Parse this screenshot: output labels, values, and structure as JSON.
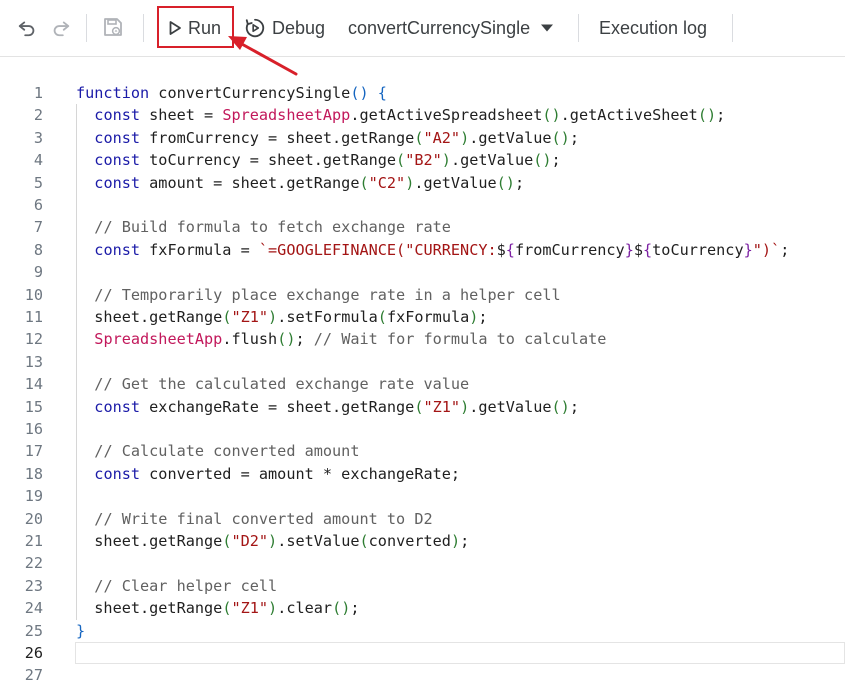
{
  "toolbar": {
    "undo_icon": "undo-icon",
    "redo_icon": "redo-icon",
    "save_icon": "save-drive-icon",
    "run_label": "Run",
    "debug_label": "Debug",
    "function_select": "convertCurrencySingle",
    "execution_log_label": "Execution log"
  },
  "editor": {
    "active_line": 26,
    "lines": [
      {
        "n": "1",
        "tokens": [
          [
            "kw",
            "function"
          ],
          [
            "pn",
            " convertCurrencySingle"
          ],
          [
            "p1",
            "()"
          ],
          [
            "pn",
            " "
          ],
          [
            "p1",
            "{"
          ]
        ]
      },
      {
        "n": "2",
        "tokens": [
          [
            "pn",
            "  "
          ],
          [
            "kw",
            "const"
          ],
          [
            "pn",
            " sheet = "
          ],
          [
            "cls",
            "SpreadsheetApp"
          ],
          [
            "pn",
            ".getActiveSpreadsheet"
          ],
          [
            "p2",
            "()"
          ],
          [
            "pn",
            ".getActiveSheet"
          ],
          [
            "p2",
            "()"
          ],
          [
            "pn",
            ";"
          ]
        ]
      },
      {
        "n": "3",
        "tokens": [
          [
            "pn",
            "  "
          ],
          [
            "kw",
            "const"
          ],
          [
            "pn",
            " fromCurrency = sheet.getRange"
          ],
          [
            "p2",
            "("
          ],
          [
            "str",
            "\"A2\""
          ],
          [
            "p2",
            ")"
          ],
          [
            "pn",
            ".getValue"
          ],
          [
            "p2",
            "()"
          ],
          [
            "pn",
            ";"
          ]
        ]
      },
      {
        "n": "4",
        "tokens": [
          [
            "pn",
            "  "
          ],
          [
            "kw",
            "const"
          ],
          [
            "pn",
            " toCurrency = sheet.getRange"
          ],
          [
            "p2",
            "("
          ],
          [
            "str",
            "\"B2\""
          ],
          [
            "p2",
            ")"
          ],
          [
            "pn",
            ".getValue"
          ],
          [
            "p2",
            "()"
          ],
          [
            "pn",
            ";"
          ]
        ]
      },
      {
        "n": "5",
        "tokens": [
          [
            "pn",
            "  "
          ],
          [
            "kw",
            "const"
          ],
          [
            "pn",
            " amount = sheet.getRange"
          ],
          [
            "p2",
            "("
          ],
          [
            "str",
            "\"C2\""
          ],
          [
            "p2",
            ")"
          ],
          [
            "pn",
            ".getValue"
          ],
          [
            "p2",
            "()"
          ],
          [
            "pn",
            ";"
          ]
        ]
      },
      {
        "n": "6",
        "tokens": []
      },
      {
        "n": "7",
        "tokens": [
          [
            "pn",
            "  "
          ],
          [
            "cm",
            "// Build formula to fetch exchange rate"
          ]
        ]
      },
      {
        "n": "8",
        "tokens": [
          [
            "pn",
            "  "
          ],
          [
            "kw",
            "const"
          ],
          [
            "pn",
            " fxFormula = "
          ],
          [
            "tpl",
            "`=GOOGLEFINANCE(\"CURRENCY:"
          ],
          [
            "pn",
            "$"
          ],
          [
            "p3",
            "{"
          ],
          [
            "pn",
            "fromCurrency"
          ],
          [
            "p3",
            "}"
          ],
          [
            "pn",
            "$"
          ],
          [
            "p3",
            "{"
          ],
          [
            "pn",
            "toCurrency"
          ],
          [
            "p3",
            "}"
          ],
          [
            "tpl",
            "\")`"
          ],
          [
            "pn",
            ";"
          ]
        ]
      },
      {
        "n": "9",
        "tokens": []
      },
      {
        "n": "10",
        "tokens": [
          [
            "pn",
            "  "
          ],
          [
            "cm",
            "// Temporarily place exchange rate in a helper cell"
          ]
        ]
      },
      {
        "n": "11",
        "tokens": [
          [
            "pn",
            "  sheet.getRange"
          ],
          [
            "p2",
            "("
          ],
          [
            "str",
            "\"Z1\""
          ],
          [
            "p2",
            ")"
          ],
          [
            "pn",
            ".setFormula"
          ],
          [
            "p2",
            "("
          ],
          [
            "pn",
            "fxFormula"
          ],
          [
            "p2",
            ")"
          ],
          [
            "pn",
            ";"
          ]
        ]
      },
      {
        "n": "12",
        "tokens": [
          [
            "pn",
            "  "
          ],
          [
            "cls",
            "SpreadsheetApp"
          ],
          [
            "pn",
            ".flush"
          ],
          [
            "p2",
            "()"
          ],
          [
            "pn",
            "; "
          ],
          [
            "cm",
            "// Wait for formula to calculate"
          ]
        ]
      },
      {
        "n": "13",
        "tokens": []
      },
      {
        "n": "14",
        "tokens": [
          [
            "pn",
            "  "
          ],
          [
            "cm",
            "// Get the calculated exchange rate value"
          ]
        ]
      },
      {
        "n": "15",
        "tokens": [
          [
            "pn",
            "  "
          ],
          [
            "kw",
            "const"
          ],
          [
            "pn",
            " exchangeRate = sheet.getRange"
          ],
          [
            "p2",
            "("
          ],
          [
            "str",
            "\"Z1\""
          ],
          [
            "p2",
            ")"
          ],
          [
            "pn",
            ".getValue"
          ],
          [
            "p2",
            "()"
          ],
          [
            "pn",
            ";"
          ]
        ]
      },
      {
        "n": "16",
        "tokens": []
      },
      {
        "n": "17",
        "tokens": [
          [
            "pn",
            "  "
          ],
          [
            "cm",
            "// Calculate converted amount"
          ]
        ]
      },
      {
        "n": "18",
        "tokens": [
          [
            "pn",
            "  "
          ],
          [
            "kw",
            "const"
          ],
          [
            "pn",
            " converted = amount * exchangeRate;"
          ]
        ]
      },
      {
        "n": "19",
        "tokens": []
      },
      {
        "n": "20",
        "tokens": [
          [
            "pn",
            "  "
          ],
          [
            "cm",
            "// Write final converted amount to D2"
          ]
        ]
      },
      {
        "n": "21",
        "tokens": [
          [
            "pn",
            "  sheet.getRange"
          ],
          [
            "p2",
            "("
          ],
          [
            "str",
            "\"D2\""
          ],
          [
            "p2",
            ")"
          ],
          [
            "pn",
            ".setValue"
          ],
          [
            "p2",
            "("
          ],
          [
            "pn",
            "converted"
          ],
          [
            "p2",
            ")"
          ],
          [
            "pn",
            ";"
          ]
        ]
      },
      {
        "n": "22",
        "tokens": []
      },
      {
        "n": "23",
        "tokens": [
          [
            "pn",
            "  "
          ],
          [
            "cm",
            "// Clear helper cell"
          ]
        ]
      },
      {
        "n": "24",
        "tokens": [
          [
            "pn",
            "  sheet.getRange"
          ],
          [
            "p2",
            "("
          ],
          [
            "str",
            "\"Z1\""
          ],
          [
            "p2",
            ")"
          ],
          [
            "pn",
            ".clear"
          ],
          [
            "p2",
            "()"
          ],
          [
            "pn",
            ";"
          ]
        ]
      },
      {
        "n": "25",
        "tokens": [
          [
            "p1",
            "}"
          ]
        ]
      },
      {
        "n": "26",
        "tokens": []
      },
      {
        "n": "27",
        "tokens": []
      }
    ]
  },
  "colors": {
    "highlight": "#d8202a",
    "keyword": "#1b1ba8",
    "class": "#c2185b",
    "string": "#a31515",
    "comment": "#616161"
  }
}
